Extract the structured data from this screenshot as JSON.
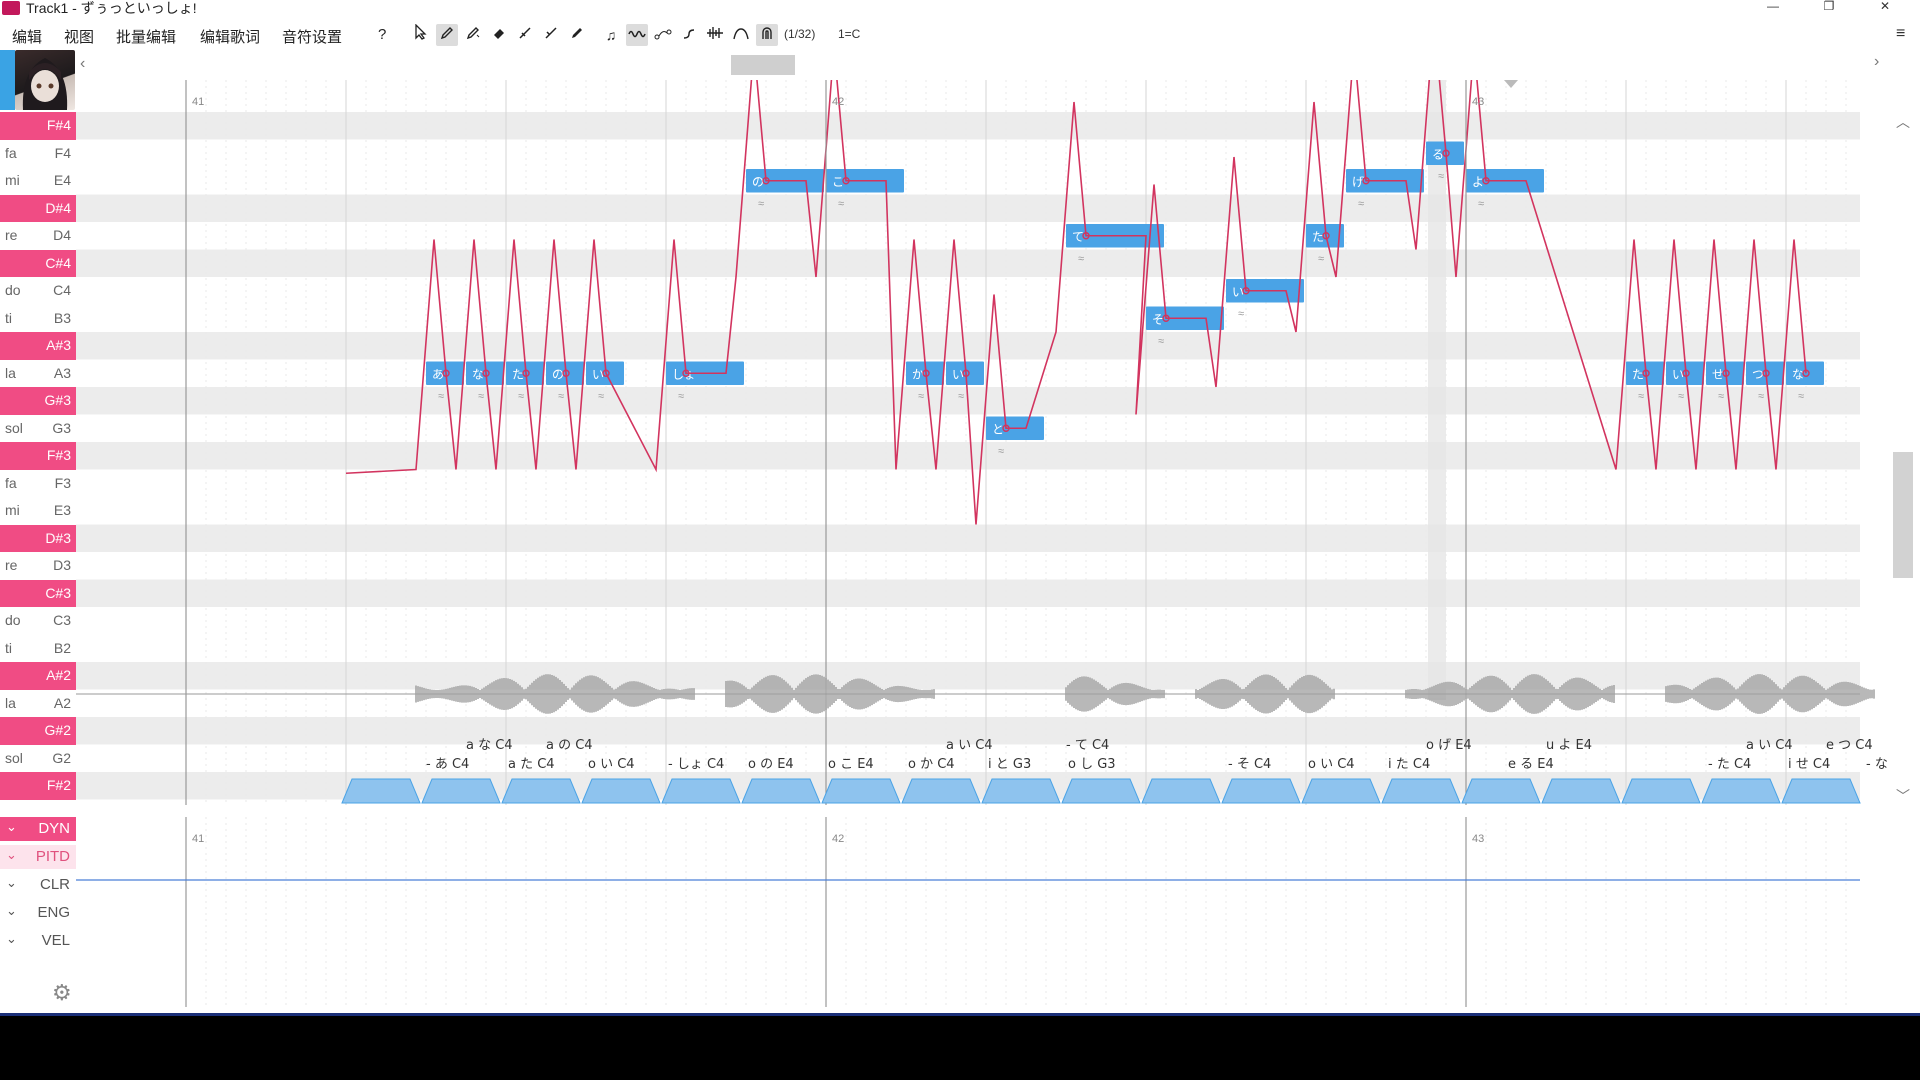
{
  "window": {
    "title": "Track1 - ずぅっといっしょ!",
    "controls": [
      "—",
      "❐",
      "✕"
    ]
  },
  "menu": [
    "编辑",
    "视图",
    "批量编辑",
    "编辑歌词",
    "音符设置"
  ],
  "toolbar": {
    "help": "?",
    "quantize": "(1/32)",
    "key": "1=C",
    "settings_icon": "≡"
  },
  "keys": [
    {
      "note": "F#4",
      "solfa": "",
      "sharp": true
    },
    {
      "note": "F4",
      "solfa": "fa",
      "sharp": false
    },
    {
      "note": "E4",
      "solfa": "mi",
      "sharp": false
    },
    {
      "note": "D#4",
      "solfa": "",
      "sharp": true
    },
    {
      "note": "D4",
      "solfa": "re",
      "sharp": false
    },
    {
      "note": "C#4",
      "solfa": "",
      "sharp": true
    },
    {
      "note": "C4",
      "solfa": "do",
      "sharp": false
    },
    {
      "note": "B3",
      "solfa": "ti",
      "sharp": false
    },
    {
      "note": "A#3",
      "solfa": "",
      "sharp": true
    },
    {
      "note": "A3",
      "solfa": "la",
      "sharp": false
    },
    {
      "note": "G#3",
      "solfa": "",
      "sharp": true
    },
    {
      "note": "G3",
      "solfa": "sol",
      "sharp": false
    },
    {
      "note": "F#3",
      "solfa": "",
      "sharp": true
    },
    {
      "note": "F3",
      "solfa": "fa",
      "sharp": false
    },
    {
      "note": "E3",
      "solfa": "mi",
      "sharp": false
    },
    {
      "note": "D#3",
      "solfa": "",
      "sharp": true
    },
    {
      "note": "D3",
      "solfa": "re",
      "sharp": false
    },
    {
      "note": "C#3",
      "solfa": "",
      "sharp": true
    },
    {
      "note": "C3",
      "solfa": "do",
      "sharp": false
    },
    {
      "note": "B2",
      "solfa": "ti",
      "sharp": false
    },
    {
      "note": "A#2",
      "solfa": "",
      "sharp": true
    },
    {
      "note": "A2",
      "solfa": "la",
      "sharp": false
    },
    {
      "note": "G#2",
      "solfa": "",
      "sharp": true
    },
    {
      "note": "G2",
      "solfa": "sol",
      "sharp": false
    },
    {
      "note": "F#2",
      "solfa": "",
      "sharp": true
    }
  ],
  "measures": [
    "41",
    "42",
    "43"
  ],
  "notes": [
    {
      "lyric": "あ",
      "pitch": "A3",
      "beat": 0.0,
      "len": 0.25
    },
    {
      "lyric": "な",
      "pitch": "A3",
      "beat": 0.25,
      "len": 0.25
    },
    {
      "lyric": "た",
      "pitch": "A3",
      "beat": 0.5,
      "len": 0.25
    },
    {
      "lyric": "の",
      "pitch": "A3",
      "beat": 0.75,
      "len": 0.25
    },
    {
      "lyric": "い",
      "pitch": "A3",
      "beat": 1.0,
      "len": 0.25
    },
    {
      "lyric": "しょ",
      "pitch": "A3",
      "beat": 1.5,
      "len": 0.5
    },
    {
      "lyric": "の",
      "pitch": "E4",
      "beat": 2.0,
      "len": 0.5
    },
    {
      "lyric": "こ",
      "pitch": "E4",
      "beat": 2.5,
      "len": 0.5
    },
    {
      "lyric": "か",
      "pitch": "A3",
      "beat": 3.0,
      "len": 0.25
    },
    {
      "lyric": "い",
      "pitch": "A3",
      "beat": 3.25,
      "len": 0.25
    },
    {
      "lyric": "と",
      "pitch": "G3",
      "beat": 3.5,
      "len": 0.375
    },
    {
      "lyric": "て",
      "pitch": "D4",
      "beat": 4.0,
      "len": 0.625
    },
    {
      "lyric": "そ",
      "pitch": "B3",
      "beat": 4.5,
      "len": 0.5
    },
    {
      "lyric": "い",
      "pitch": "C4",
      "beat": 5.0,
      "len": 0.5
    },
    {
      "lyric": "た",
      "pitch": "D4",
      "beat": 5.5,
      "len": 0.25
    },
    {
      "lyric": "げ",
      "pitch": "E4",
      "beat": 5.75,
      "len": 0.5
    },
    {
      "lyric": "る",
      "pitch": "F4",
      "beat": 6.25,
      "len": 0.25
    },
    {
      "lyric": "よ",
      "pitch": "E4",
      "beat": 6.5,
      "len": 0.5
    },
    {
      "lyric": "た",
      "pitch": "A3",
      "beat": 7.5,
      "len": 0.25
    },
    {
      "lyric": "い",
      "pitch": "A3",
      "beat": 7.75,
      "len": 0.25
    },
    {
      "lyric": "せ",
      "pitch": "A3",
      "beat": 8.0,
      "len": 0.25
    },
    {
      "lyric": "つ",
      "pitch": "A3",
      "beat": 8.25,
      "len": 0.25
    },
    {
      "lyric": "な",
      "pitch": "A3",
      "beat": 8.5,
      "len": 0.25
    }
  ],
  "phoneme_row1": [
    "a な C4",
    "a の C4",
    "a い C4",
    "- て C4",
    "o げ E4",
    "u よ E4",
    "a い C4",
    "e つ C4"
  ],
  "phoneme_row2": [
    "- あ C4",
    "a た C4",
    "o い C4",
    "- しょ C4",
    "o の E4",
    "o こ E4",
    "o か C4",
    "i と G3",
    "o し G3",
    "- そ C4",
    "o い C4",
    "i た C4",
    "e る E4",
    "- た C4",
    "i せ C4",
    "- な"
  ],
  "params": [
    {
      "label": "DYN",
      "state": "active"
    },
    {
      "label": "PITD",
      "state": "soft"
    },
    {
      "label": "CLR",
      "state": "normal"
    },
    {
      "label": "ENG",
      "state": "normal"
    },
    {
      "label": "VEL",
      "state": "normal"
    }
  ],
  "colors": {
    "sharp_key": "#f04c84",
    "note_fill": "#4aa3e6",
    "pitch_curve": "#d2345f",
    "waveform": "#a0a0a0",
    "accent": "#1b2f78"
  }
}
